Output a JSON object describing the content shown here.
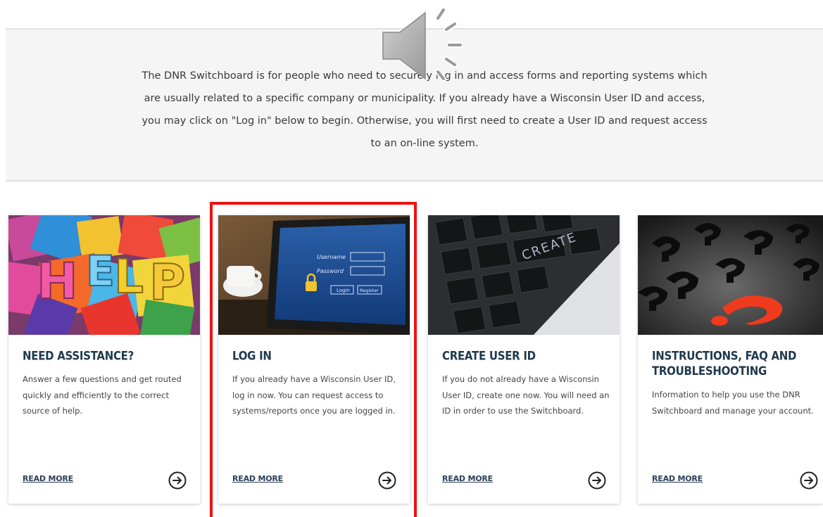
{
  "intro": {
    "text": "The DNR Switchboard is for people who need to securely log in and access forms and reporting systems which are usually related to a specific company or municipality. If you already have a Wisconsin User ID and access, you may click on  \"Log in\" below to begin. Otherwise, you will first need to create a User ID and request access to an on-line system."
  },
  "audio": {
    "icon": "speaker-icon"
  },
  "cards": [
    {
      "title": "Need Assistance?",
      "body": "Answer a few questions and get routed quickly and efficiently to the correct source of help.",
      "read_more": "READ MORE",
      "image": "help-letters-image"
    },
    {
      "title": "Log In",
      "body": "If you already have a Wisconsin User ID, log in now. You can request access to systems/reports once you are logged in.",
      "read_more": "READ MORE",
      "image": "tablet-login-image",
      "tablet_text": {
        "username": "Username",
        "password": "Password",
        "login": "Login",
        "register": "Register"
      }
    },
    {
      "title": "Create User ID",
      "body": "If you do not already have a Wisconsin User ID, create one now. You will need an ID in order to use the Switchboard.",
      "read_more": "READ MORE",
      "image": "create-keyboard-image",
      "key_text": "CREATE"
    },
    {
      "title": "Instructions, FAQ and Troubleshooting",
      "body": "Information to help you use the DNR Switchboard and manage your account.",
      "read_more": "READ MORE",
      "image": "question-marks-image"
    }
  ],
  "colors": {
    "title": "#1f3a4c",
    "highlight": "#ee1111",
    "band": "#f5f5f5"
  }
}
